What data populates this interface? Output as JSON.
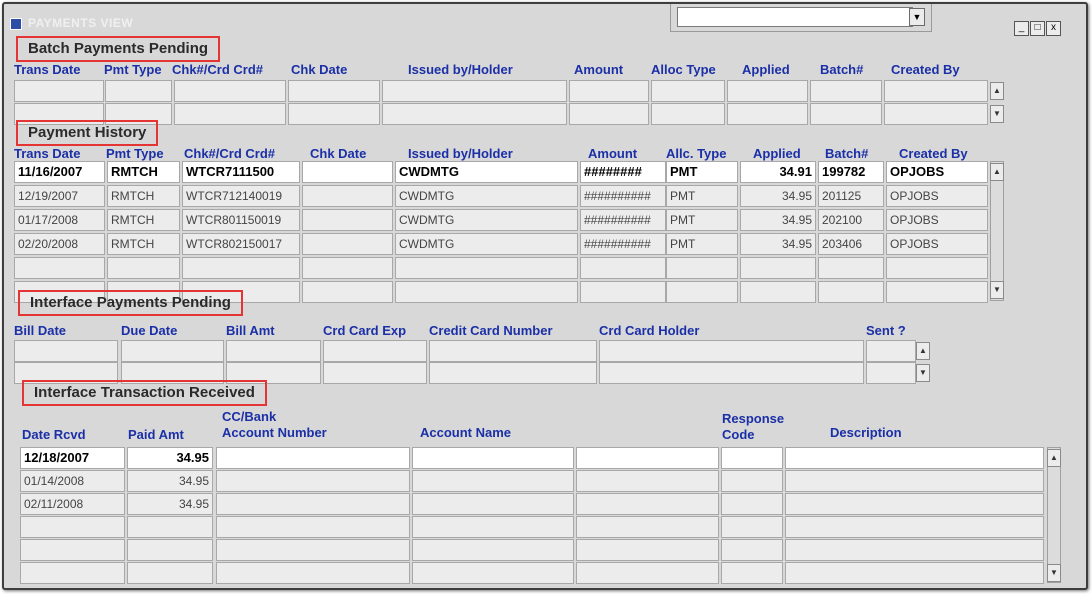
{
  "window": {
    "title": "PAYMENTS VIEW",
    "minimize": "_",
    "maximize": "□",
    "close": "x",
    "combo_arrow": "▼"
  },
  "batch": {
    "title": "Batch Payments Pending",
    "headers": [
      "Trans Date",
      "Pmt Type",
      "Chk#/Crd Crd#",
      "Chk Date",
      "Issued by/Holder",
      "Amount",
      "Alloc Type",
      "Applied",
      "Batch#",
      "Created By"
    ]
  },
  "history": {
    "title": "Payment History",
    "headers": [
      "Trans Date",
      "Pmt Type",
      "Chk#/Crd Crd#",
      "Chk Date",
      "Issued by/Holder",
      "Amount",
      "Allc. Type",
      "Applied",
      "Batch#",
      "Created By"
    ],
    "rows": [
      [
        "11/16/2007",
        "RMTCH",
        "WTCR7111500",
        "",
        "CWDMTG",
        "########",
        "PMT",
        "34.91",
        "199782",
        "OPJOBS"
      ],
      [
        "12/19/2007",
        "RMTCH",
        "WTCR712140019",
        "",
        "CWDMTG",
        "##########",
        "PMT",
        "34.95",
        "201125",
        "OPJOBS"
      ],
      [
        "01/17/2008",
        "RMTCH",
        "WTCR801150019",
        "",
        "CWDMTG",
        "##########",
        "PMT",
        "34.95",
        "202100",
        "OPJOBS"
      ],
      [
        "02/20/2008",
        "RMTCH",
        "WTCR802150017",
        "",
        "CWDMTG",
        "##########",
        "PMT",
        "34.95",
        "203406",
        "OPJOBS"
      ]
    ]
  },
  "interface_pending": {
    "title": "Interface Payments Pending",
    "headers": [
      "Bill Date",
      "Due Date",
      "Bill Amt",
      "Crd Card Exp",
      "Credit Card Number",
      "Crd Card Holder",
      "Sent ?"
    ]
  },
  "interface_received": {
    "title": "Interface Transaction Received",
    "headers": [
      "Date Rcvd",
      "Paid Amt",
      "CC/Bank",
      "Account Number",
      "Account Name",
      "Response",
      "Code",
      "Description"
    ],
    "rows": [
      [
        "12/18/2007",
        "34.95"
      ],
      [
        "01/14/2008",
        "34.95"
      ],
      [
        "02/11/2008",
        "34.95"
      ]
    ]
  }
}
